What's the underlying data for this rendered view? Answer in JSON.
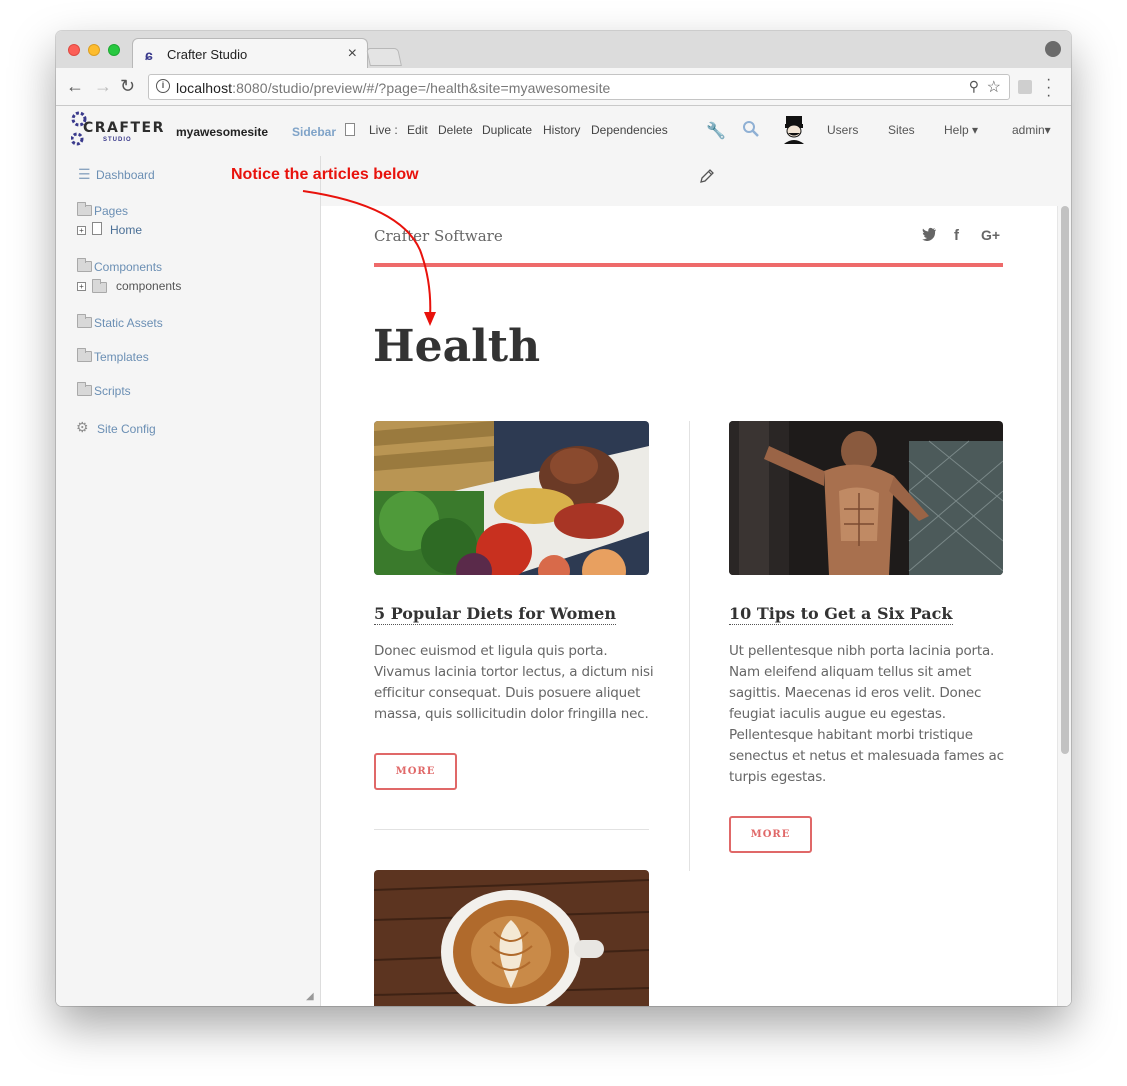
{
  "browser": {
    "tab_title": "Crafter Studio",
    "tab_close": "×",
    "url_host": "localhost",
    "url_rest": ":8080/studio/preview/#/?page=/health&site=myawesomesite"
  },
  "studio_header": {
    "logo_text": "CRAFTER",
    "logo_sub": "STUDIO",
    "site_name": "myawesomesite",
    "sidebar_label": "Sidebar",
    "live_label": "Live :",
    "actions": [
      "Edit",
      "Delete",
      "Duplicate",
      "History",
      "Dependencies"
    ],
    "users_label": "Users",
    "sites_label": "Sites",
    "help_label": "Help ▾",
    "admin_label": "admin▾"
  },
  "sidebar": {
    "dashboard": "Dashboard",
    "pages": "Pages",
    "home": "Home",
    "components": "Components",
    "components_child": "components",
    "static_assets": "Static Assets",
    "templates": "Templates",
    "scripts": "Scripts",
    "site_config": "Site Config"
  },
  "preview": {
    "site_title": "Crafter Software",
    "social": [
      "twitter-icon",
      "facebook-icon",
      "google-plus-icon"
    ],
    "social_glyphs": [
      "🐦",
      "f",
      "G+"
    ],
    "heading": "Health",
    "articles": [
      {
        "title": "5 Popular Diets for Women",
        "body": "Donec euismod et ligula quis porta. Vivamus lacinia tortor lectus, a dictum nisi efficitur consequat. Duis posuere aliquet massa, quis sollicitudin dolor fringilla nec.",
        "more": "MORE"
      },
      {
        "title": "10 Tips to Get a Six Pack",
        "body": "Ut pellentesque nibh porta lacinia porta. Nam eleifend aliquam tellus sit amet sagittis. Maecenas id eros velit. Donec feugiat iaculis augue eu egestas. Pellentesque habitant morbi tristique senectus et netus et malesuada fames ac turpis egestas.",
        "more": "MORE"
      }
    ]
  },
  "annotation": {
    "text": "Notice the articles below"
  },
  "colors": {
    "accent_red": "#ee6a6a",
    "annotation_red": "#e8120c",
    "link_blue": "#6b8fb4"
  }
}
